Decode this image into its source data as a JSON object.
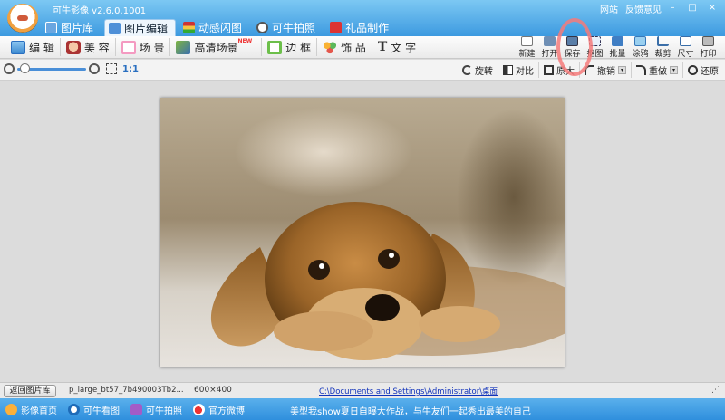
{
  "app": {
    "title": "可牛影像 v2.6.0.1001",
    "links": [
      "网站",
      "反馈意见"
    ],
    "window_buttons": [
      "–",
      "□",
      "×"
    ]
  },
  "tabs": [
    {
      "label": "图片库",
      "icon": "gallery-icon",
      "active": false
    },
    {
      "label": "图片编辑",
      "icon": "image-edit-icon",
      "active": true
    },
    {
      "label": "动感闪图",
      "icon": "film-icon",
      "active": false
    },
    {
      "label": "可牛拍照",
      "icon": "camera-icon",
      "active": false
    },
    {
      "label": "礼品制作",
      "icon": "gift-icon",
      "active": false
    }
  ],
  "edit_toolbar": [
    {
      "label": "编 辑",
      "icon": "edit-picture-icon"
    },
    {
      "label": "美 容",
      "icon": "face-beauty-icon"
    },
    {
      "label": "场 景",
      "icon": "scene-icon"
    },
    {
      "label": "高清场景",
      "icon": "hd-scene-icon",
      "badge": "NEW"
    },
    {
      "label": "边 框",
      "icon": "frame-icon"
    },
    {
      "label": "饰 品",
      "icon": "clover-icon"
    },
    {
      "label": "文 字",
      "icon": "text-icon",
      "glyph": "T"
    }
  ],
  "right_tools": [
    {
      "label": "新建",
      "icon": "new-file-icon"
    },
    {
      "label": "打开",
      "icon": "open-folder-icon"
    },
    {
      "label": "保存",
      "icon": "save-icon"
    },
    {
      "label": "抠图",
      "icon": "cutout-icon"
    },
    {
      "label": "批量",
      "icon": "batch-icon"
    },
    {
      "label": "涂鸦",
      "icon": "doodle-icon"
    },
    {
      "label": "裁剪",
      "icon": "crop-icon"
    },
    {
      "label": "尺寸",
      "icon": "resize-icon"
    },
    {
      "label": "打印",
      "icon": "print-icon"
    }
  ],
  "zoom": {
    "ratio_label": "1:1",
    "level": 0.04
  },
  "zoom_actions": [
    {
      "label": "旋转",
      "icon": "rotate-icon",
      "dropdown": false
    },
    {
      "label": "对比",
      "icon": "compare-icon",
      "dropdown": false
    },
    {
      "label": "原大",
      "icon": "actual-size-icon",
      "dropdown": false
    },
    {
      "label": "撤销",
      "icon": "undo-icon",
      "dropdown": true
    },
    {
      "label": "重做",
      "icon": "redo-icon",
      "dropdown": true
    },
    {
      "label": "还原",
      "icon": "restore-icon",
      "dropdown": false
    }
  ],
  "status": {
    "back_button": "返回图片库",
    "file_name": "p_large_bt57_7b490003Tb2...",
    "dimensions": "600×400",
    "path": "C:\\Documents and Settings\\Administrator\\桌面",
    "resize_grip": "⋰"
  },
  "bottom_bar": {
    "links": [
      {
        "label": "影像首页",
        "icon": "home-icon"
      },
      {
        "label": "可牛看图",
        "icon": "eye-icon"
      },
      {
        "label": "可牛拍照",
        "icon": "camera-icon"
      },
      {
        "label": "官方微博",
        "icon": "weibo-icon"
      }
    ],
    "promo": "美型我show夏日自曝大作战，与牛友们一起秀出最美的自己"
  },
  "colors": {
    "title_bar": "#3d9ae0",
    "accent": "#2a6fc0",
    "highlight_ring": "#f47a7a",
    "link": "#1133bb"
  }
}
